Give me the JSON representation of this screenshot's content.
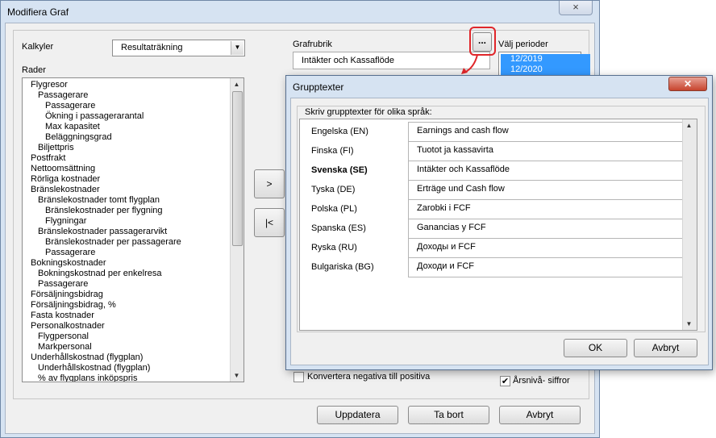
{
  "window": {
    "title": "Modifiera Graf",
    "close_icon": "×"
  },
  "kalkyler": {
    "label": "Kalkyler",
    "value": "Resultaträkning"
  },
  "rader": {
    "label": "Rader",
    "items": [
      {
        "text": "Flygresor",
        "level": 0
      },
      {
        "text": "Passagerare",
        "level": 1
      },
      {
        "text": "Passagerare",
        "level": 2
      },
      {
        "text": "Ökning i passagerarantal",
        "level": 2
      },
      {
        "text": "Max kapasitet",
        "level": 2
      },
      {
        "text": "Beläggningsgrad",
        "level": 2
      },
      {
        "text": "Biljettpris",
        "level": 1
      },
      {
        "text": "Postfrakt",
        "level": 0
      },
      {
        "text": "Nettoomsättning",
        "level": 0
      },
      {
        "text": "Rörliga kostnader",
        "level": 0
      },
      {
        "text": "Bränslekostnader",
        "level": 0
      },
      {
        "text": "Bränslekostnader tomt flygplan",
        "level": 1
      },
      {
        "text": "Bränslekostnader per flygning",
        "level": 2
      },
      {
        "text": "Flygningar",
        "level": 2
      },
      {
        "text": "Bränslekostnader passagerarvikt",
        "level": 1
      },
      {
        "text": "Bränslekostnader per passagerare",
        "level": 2
      },
      {
        "text": "Passagerare",
        "level": 2
      },
      {
        "text": "Bokningskostnader",
        "level": 0
      },
      {
        "text": "Bokningskostnad per enkelresa",
        "level": 1
      },
      {
        "text": "Passagerare",
        "level": 1
      },
      {
        "text": "Försäljningsbidrag",
        "level": 0
      },
      {
        "text": "Försäljningsbidrag, %",
        "level": 0
      },
      {
        "text": "Fasta kostnader",
        "level": 0
      },
      {
        "text": "Personalkostnader",
        "level": 0
      },
      {
        "text": "Flygpersonal",
        "level": 1
      },
      {
        "text": "Markpersonal",
        "level": 1
      },
      {
        "text": "Underhållskostnad (flygplan)",
        "level": 0
      },
      {
        "text": "Underhållskostnad (flygplan)",
        "level": 1
      },
      {
        "text": "% av flygplans inköpspris",
        "level": 1
      }
    ]
  },
  "move_buttons": {
    "add": ">",
    "remove_all": "|<"
  },
  "grafrubrik": {
    "label": "Grafrubrik",
    "value": "Intäkter och Kassaflöde",
    "browse_label": "..."
  },
  "perioder": {
    "label": "Välj perioder",
    "items": [
      "12/2019",
      "12/2020"
    ]
  },
  "checkboxes": {
    "konvertera": {
      "label": "Konvertera negativa till positiva",
      "checked": false
    },
    "arsniva": {
      "label": "Årsnivå- siffror",
      "checked": true,
      "check_mark": "✔"
    }
  },
  "footer": {
    "update": "Uppdatera",
    "delete": "Ta bort",
    "cancel": "Avbryt"
  },
  "scroll_icons": {
    "up": "▲",
    "down": "▼"
  },
  "combo_arrow": "▼",
  "dialog": {
    "title": "Grupptexter",
    "close_icon": "✕",
    "instruction": "Skriv grupptexter för olika språk:",
    "rows": [
      {
        "language": "Engelska (EN)",
        "text": "Earnings and cash flow",
        "bold": false
      },
      {
        "language": "Finska (FI)",
        "text": "Tuotot ja kassavirta",
        "bold": false
      },
      {
        "language": "Svenska (SE)",
        "text": "Intäkter och Kassaflöde",
        "bold": true
      },
      {
        "language": "Tyska (DE)",
        "text": "Erträge und Cash flow",
        "bold": false
      },
      {
        "language": "Polska (PL)",
        "text": "Zarobki i FCF",
        "bold": false
      },
      {
        "language": "Spanska (ES)",
        "text": "Ganancias y FCF",
        "bold": false
      },
      {
        "language": "Ryska (RU)",
        "text": "Доходы и FCF",
        "bold": false
      },
      {
        "language": "Bulgariska (BG)",
        "text": "Доходи и FCF",
        "bold": false
      }
    ],
    "ok": "OK",
    "cancel": "Avbryt"
  },
  "colors": {
    "selection": "#3399ff",
    "annotation": "#e0262a",
    "window_frame": "#d6e3f2"
  }
}
